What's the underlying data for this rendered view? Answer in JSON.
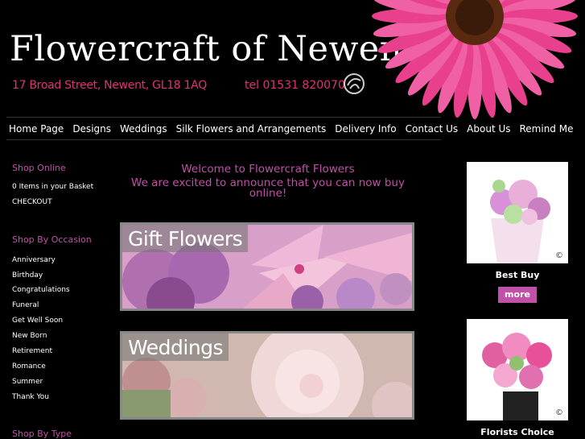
{
  "header": {
    "title": "Flowercraft of Newent",
    "address": "17 Broad Street, Newent, GL18 1AQ",
    "phone": "tel 01531 820070"
  },
  "nav": [
    "Home Page",
    "Designs",
    "Weddings",
    "Silk Flowers and Arrangements",
    "Delivery Info",
    "Contact Us",
    "About Us",
    "Remind Me"
  ],
  "sidebar": {
    "shop_online": "Shop Online",
    "basket": "0 Items in your Basket",
    "checkout": "CHECKOUT",
    "shop_by_occasion": "Shop By Occasion",
    "occasions": [
      "Anniversary",
      "Birthday",
      "Congratulations",
      "Funeral",
      "Get Well Soon",
      "New Born",
      "Retirement",
      "Romance",
      "Summer",
      "Thank You"
    ],
    "shop_by_type": "Shop By Type"
  },
  "main": {
    "welcome": "Welcome to Flowercraft Flowers",
    "announce": "We are excited to announce that you can now buy online!",
    "banners": [
      "Gift Flowers",
      "Weddings"
    ]
  },
  "products": [
    {
      "name": "Best Buy",
      "button": "more",
      "copyright": "©"
    },
    {
      "name": "Florists Choice",
      "copyright": "©"
    }
  ],
  "colors": {
    "accent": "#c050a8",
    "address": "#e0307a",
    "background": "#000000"
  }
}
